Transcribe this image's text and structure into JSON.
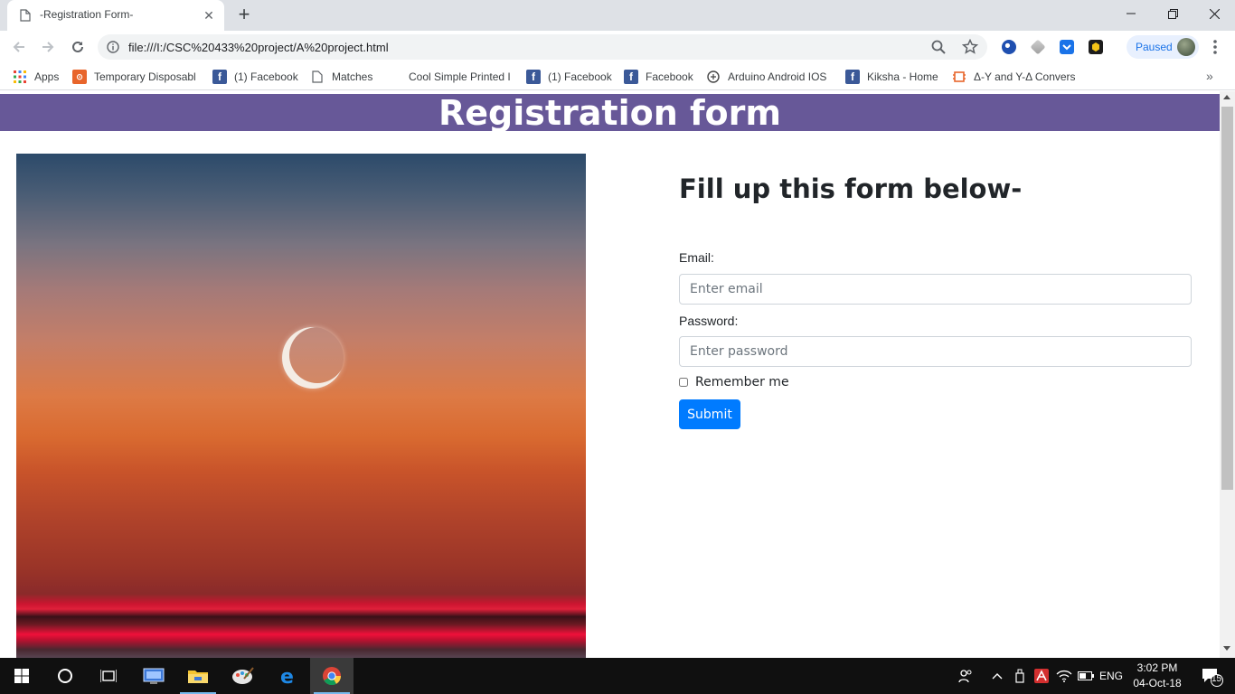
{
  "browser": {
    "tab_title": "-Registration Form-",
    "url": "file:///I:/CSC%20433%20project/A%20project.html",
    "profile_status": "Paused",
    "bookmarks": [
      {
        "label": "Apps",
        "icon": "apps-grid-icon"
      },
      {
        "label": "Temporary Disposabl",
        "icon": "temp-mail-icon"
      },
      {
        "label": "(1) Facebook",
        "icon": "facebook-icon"
      },
      {
        "label": "Matches",
        "icon": "page-icon"
      },
      {
        "label": "Cool Simple Printed I",
        "icon": "none"
      },
      {
        "label": "(1) Facebook",
        "icon": "facebook-icon"
      },
      {
        "label": "Facebook",
        "icon": "facebook-icon"
      },
      {
        "label": "Arduino Android IOS",
        "icon": "arduino-icon"
      },
      {
        "label": "Kiksha - Home",
        "icon": "facebook-icon"
      },
      {
        "label": "Δ-Y and Y-Δ Convers",
        "icon": "circuit-icon"
      }
    ]
  },
  "page": {
    "header_title": "Registration form",
    "form": {
      "heading": "Fill up this form below-",
      "email_label": "Email:",
      "email_placeholder": "Enter email",
      "password_label": "Password:",
      "password_placeholder": "Enter password",
      "remember_label": "Remember me",
      "remember_checked": false,
      "submit_label": "Submit"
    },
    "colors": {
      "header_bg": "#675898",
      "submit_bg": "#007bff"
    }
  },
  "taskbar": {
    "apps": [
      "start-icon",
      "cortana-icon",
      "task-view-icon",
      "remote-desktop-icon",
      "file-explorer-icon",
      "paint-icon",
      "edge-icon",
      "chrome-icon"
    ],
    "language": "ENG",
    "time": "3:02 PM",
    "date": "04-Oct-18",
    "notification_count": "15"
  }
}
